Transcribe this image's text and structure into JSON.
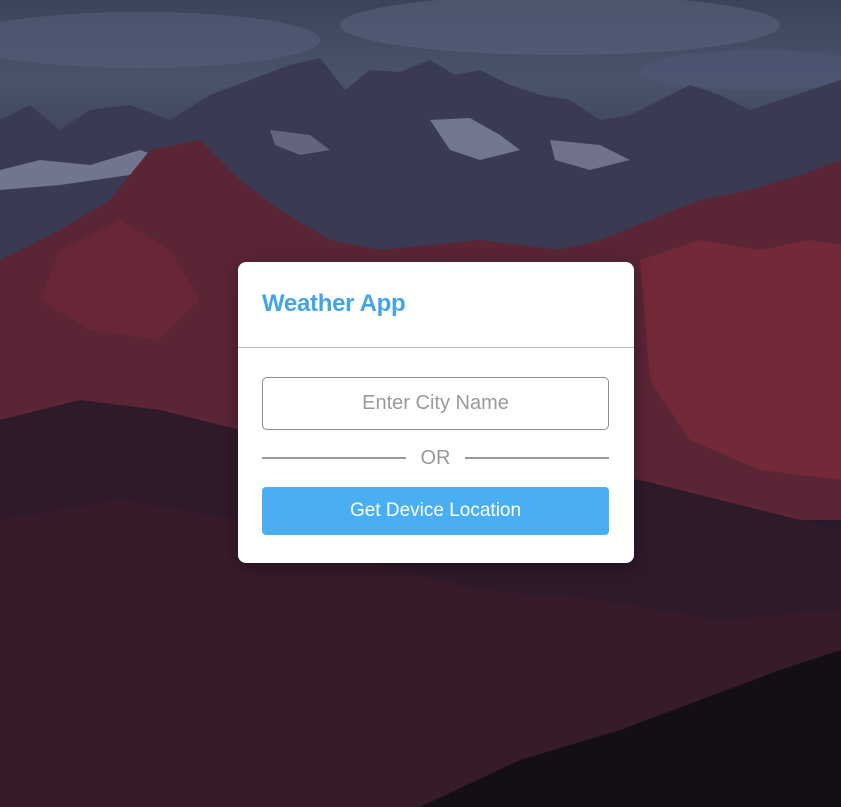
{
  "app": {
    "title": "Weather App"
  },
  "form": {
    "city_placeholder": "Enter City Name",
    "city_value": "",
    "separator_text": "OR",
    "location_button_label": "Get Device Location"
  },
  "colors": {
    "accent": "#43a4e6",
    "button": "#4aaef2",
    "card_background": "#ffffff"
  }
}
